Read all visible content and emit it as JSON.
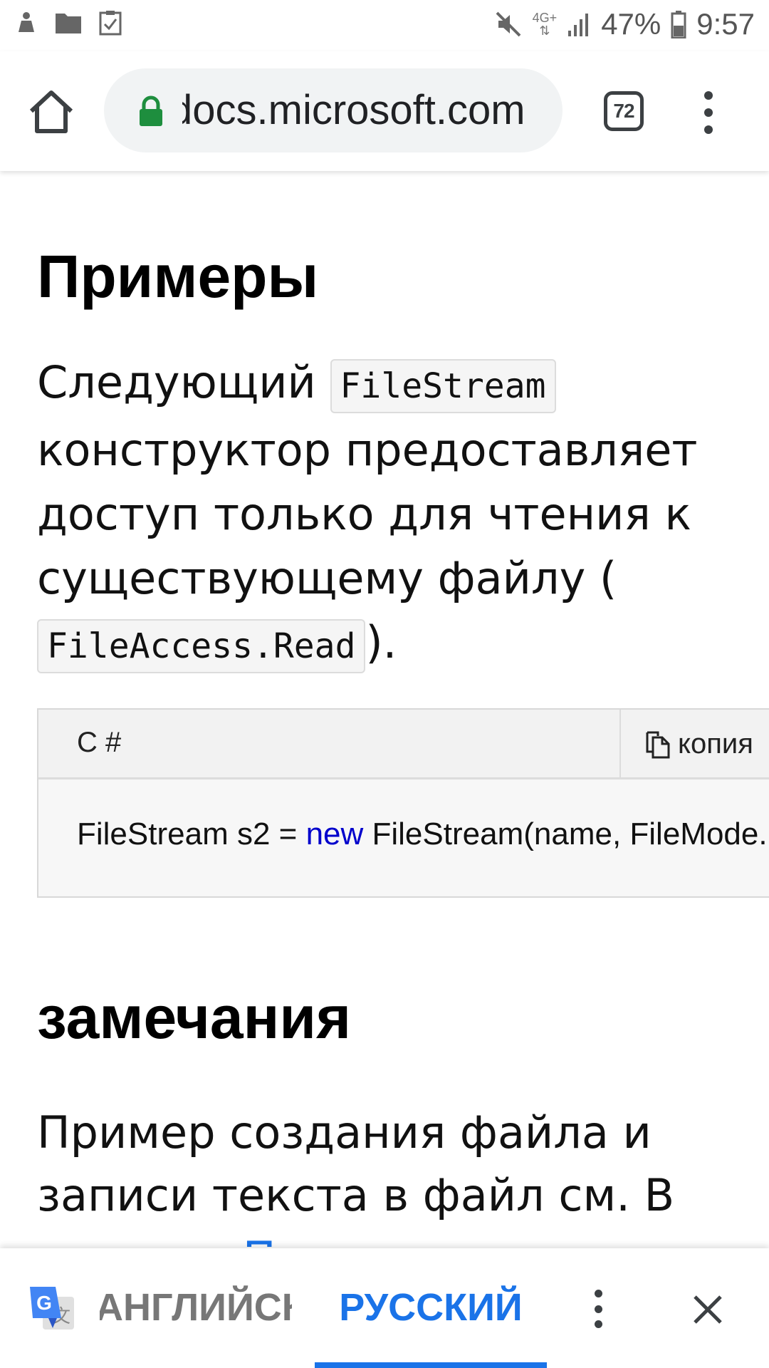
{
  "status_bar": {
    "network": "4G+",
    "battery": "47%",
    "time": "9:57"
  },
  "browser": {
    "url": "docs.microsoft.com",
    "tab_count": "72"
  },
  "content": {
    "heading_examples": "Примеры",
    "para1_part1": "Следующий ",
    "para1_code1": "FileStream",
    "para1_part2": " конструктор предоставляет доступ только для чтения к существующему файлу ( ",
    "para1_code2": "FileAccess.Read",
    "para1_part3": ").",
    "code_block": {
      "language": "C #",
      "copy_label": "копия",
      "code_before": "FileStream s2 = ",
      "code_keyword": "new",
      "code_after": " FileStream(name, FileMode."
    },
    "heading_remarks": "замечания",
    "para2_text": "Пример создания файла и записи текста в файл см. В разделе ",
    "para2_link": "Практическое"
  },
  "translate_bar": {
    "source_language": "АНГЛИЙСКИЙ",
    "target_language": "РУССКИЙ"
  },
  "colors": {
    "accent": "#1a73e8",
    "keyword": "#0000cc",
    "lock": "#1e8e3e"
  }
}
